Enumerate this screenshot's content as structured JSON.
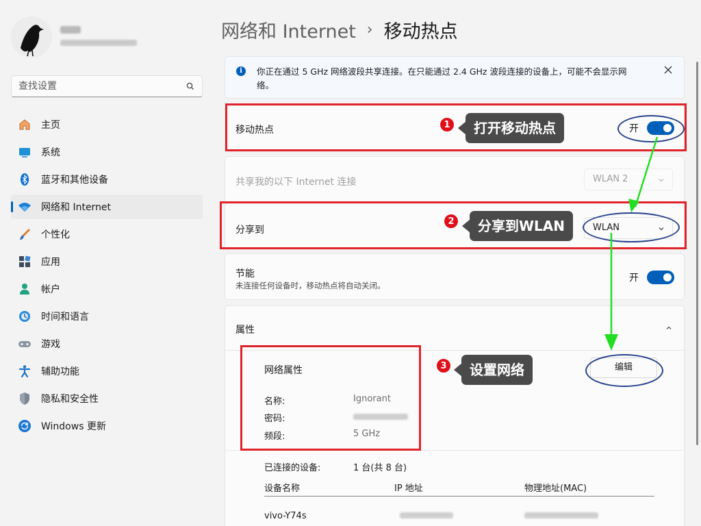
{
  "user": {
    "name_blurred": "user-name",
    "email_blurred": "user-email"
  },
  "search": {
    "placeholder": "查找设置"
  },
  "nav": {
    "items": [
      {
        "label": "主页",
        "icon": "home-icon"
      },
      {
        "label": "系统",
        "icon": "system-icon"
      },
      {
        "label": "蓝牙和其他设备",
        "icon": "bluetooth-icon"
      },
      {
        "label": "网络和 Internet",
        "icon": "wifi-icon",
        "active": true
      },
      {
        "label": "个性化",
        "icon": "brush-icon"
      },
      {
        "label": "应用",
        "icon": "apps-icon"
      },
      {
        "label": "帐户",
        "icon": "account-icon"
      },
      {
        "label": "时间和语言",
        "icon": "time-language-icon"
      },
      {
        "label": "游戏",
        "icon": "gamepad-icon"
      },
      {
        "label": "辅助功能",
        "icon": "accessibility-icon"
      },
      {
        "label": "隐私和安全性",
        "icon": "shield-icon"
      },
      {
        "label": "Windows 更新",
        "icon": "update-icon"
      }
    ]
  },
  "header": {
    "parent": "网络和 Internet",
    "separator": "›",
    "current": "移动热点"
  },
  "info": {
    "text": "你正在通过 5 GHz 网络波段共享连接。在只能通过 2.4 GHz 波段连接的设备上，可能不会显示网络。"
  },
  "hotspot": {
    "title": "移动热点",
    "state": "开"
  },
  "share_from": {
    "title": "共享我的以下 Internet 连接",
    "value": "WLAN 2"
  },
  "share_to": {
    "title": "分享到",
    "value": "WLAN"
  },
  "power_saving": {
    "title": "节能",
    "subtitle": "未连接任何设备时，移动热点将自动关闭。",
    "state": "开"
  },
  "properties": {
    "title": "属性",
    "network_props_title": "网络属性",
    "name_label": "名称:",
    "name_value": "Ignorant",
    "password_label": "密码:",
    "band_label": "频段:",
    "band_value": "5 GHz",
    "edit_label": "编辑",
    "connected_label": "已连接的设备:",
    "connected_value": "1 台(共 8 台)",
    "col_name": "设备名称",
    "col_ip": "IP 地址",
    "col_mac": "物理地址(MAC)",
    "device_name": "vivo-Y74s"
  },
  "annotations": {
    "step1_num": "1",
    "step1_text": "打开移动热点",
    "step2_num": "2",
    "step2_text": "分享到WLAN",
    "step3_num": "3",
    "step3_text": "设置网络",
    "box_color": "#e0222a",
    "ellipse_color": "#26408b",
    "arrow_color": "#22dd22"
  },
  "colors": {
    "accent": "#005fb8",
    "background": "#f3f3f3",
    "card": "#fbfbfb"
  }
}
